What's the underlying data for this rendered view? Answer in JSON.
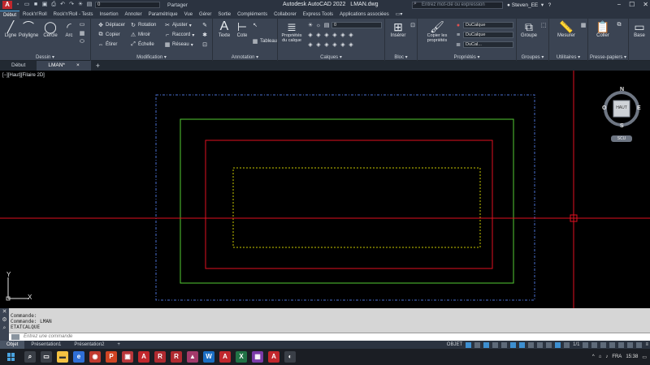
{
  "window": {
    "app_title": "Autodesk AutoCAD 2022",
    "file_title": "LMAN.dwg",
    "qat_layer": "0",
    "share_label": "Partager",
    "search_placeholder": "Entrez mot-clé ou expression",
    "user_name": "Steven_EE"
  },
  "ribbon_tabs": [
    "Début",
    "Rock'n'Roll",
    "Rock'n'Roll - Tests",
    "Insertion",
    "Annoter",
    "Paramétrique",
    "Vue",
    "Gérer",
    "Sortie",
    "Compléments",
    "Collaborer",
    "Express Tools",
    "Applications associées"
  ],
  "ribbon": {
    "dessin": {
      "title": "Dessin",
      "ligne": "Ligne",
      "polyligne": "Polyligne",
      "cercle": "Cercle",
      "arc": "Arc"
    },
    "modification": {
      "title": "Modification",
      "deplacer": "Déplacer",
      "rotation": "Rotation",
      "ajuster": "Ajuster",
      "copier": "Copier",
      "miroir": "Miroir",
      "raccord": "Raccord",
      "etirer": "Étirer",
      "echelle": "Échelle",
      "reseau": "Réseau"
    },
    "annotation": {
      "title": "Annotation",
      "texte": "Texte",
      "cote": "Cote",
      "tableau": "Tableau"
    },
    "calques": {
      "title": "Calques",
      "proprietes": "Propriétés du calque",
      "layer_value": "0"
    },
    "bloc": {
      "title": "Bloc",
      "inserer": "Insérer"
    },
    "proprietes": {
      "title": "Propriétés",
      "copier": "Copier les propriétés",
      "couleur": "DuCalque",
      "type_ligne": "DuCalque",
      "epaisseur": "DuCal..."
    },
    "groupes": {
      "title": "Groupes",
      "groupe": "Groupe"
    },
    "utilitaires": {
      "title": "Utilitaires",
      "mesurer": "Mesurer"
    },
    "presse_papiers": {
      "title": "Presse-papiers",
      "coller": "Coller"
    },
    "vue": {
      "base": "Base"
    }
  },
  "file_tabs": [
    "Début",
    "LMAN*"
  ],
  "viewport": {
    "label": "[−][Haut][Filaire 2D]",
    "viewcube_face": "HAUT",
    "compass": {
      "n": "N",
      "s": "S",
      "e": "E",
      "o": "O"
    },
    "nav_badge": "SCU",
    "ucs_x": "X",
    "ucs_y": "Y"
  },
  "command": {
    "history": [
      "Commande:",
      "Commande: LMAN",
      "ETATCALQUE"
    ],
    "placeholder": "Entrez une commande"
  },
  "layout_tabs": [
    "Objet",
    "Présentation1",
    "Présentation2"
  ],
  "status": {
    "mode": "OBJET",
    "scale": "1/1"
  },
  "taskbar": {
    "lang": "FRA",
    "time": "15:38"
  },
  "colors": {
    "green_rect": "#55cc33",
    "red_rect": "#e01020",
    "yellow_rect": "#c8c800",
    "blue_rect": "#4a6fd0",
    "crosshair": "#e01020",
    "accent": "#4aa3df"
  }
}
